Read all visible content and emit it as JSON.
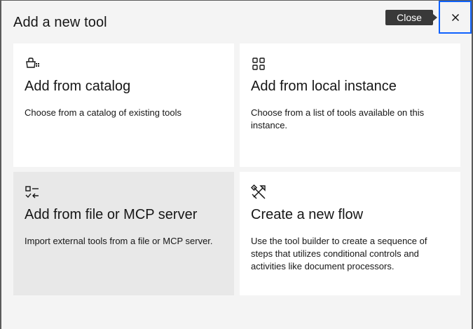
{
  "modal": {
    "title": "Add a new tool",
    "close_tooltip": "Close"
  },
  "tiles": [
    {
      "title": "Add from catalog",
      "description": "Choose from a catalog of existing tools",
      "icon": "catalog-icon"
    },
    {
      "title": "Add from local instance",
      "description": "Choose from a list of tools available on this instance.",
      "icon": "grid-icon"
    },
    {
      "title": "Add from file or MCP server",
      "description": "Import external tools from a file or MCP server.",
      "icon": "import-list-icon"
    },
    {
      "title": "Create a new flow",
      "description": "Use the tool builder to create a sequence of steps that utilizes conditional controls and activities like document processors.",
      "icon": "tools-icon"
    }
  ],
  "colors": {
    "focus": "#0f62fe",
    "tile": "#ffffff",
    "tile_hover": "#e8e8e8",
    "modal_bg": "#f4f4f4"
  }
}
